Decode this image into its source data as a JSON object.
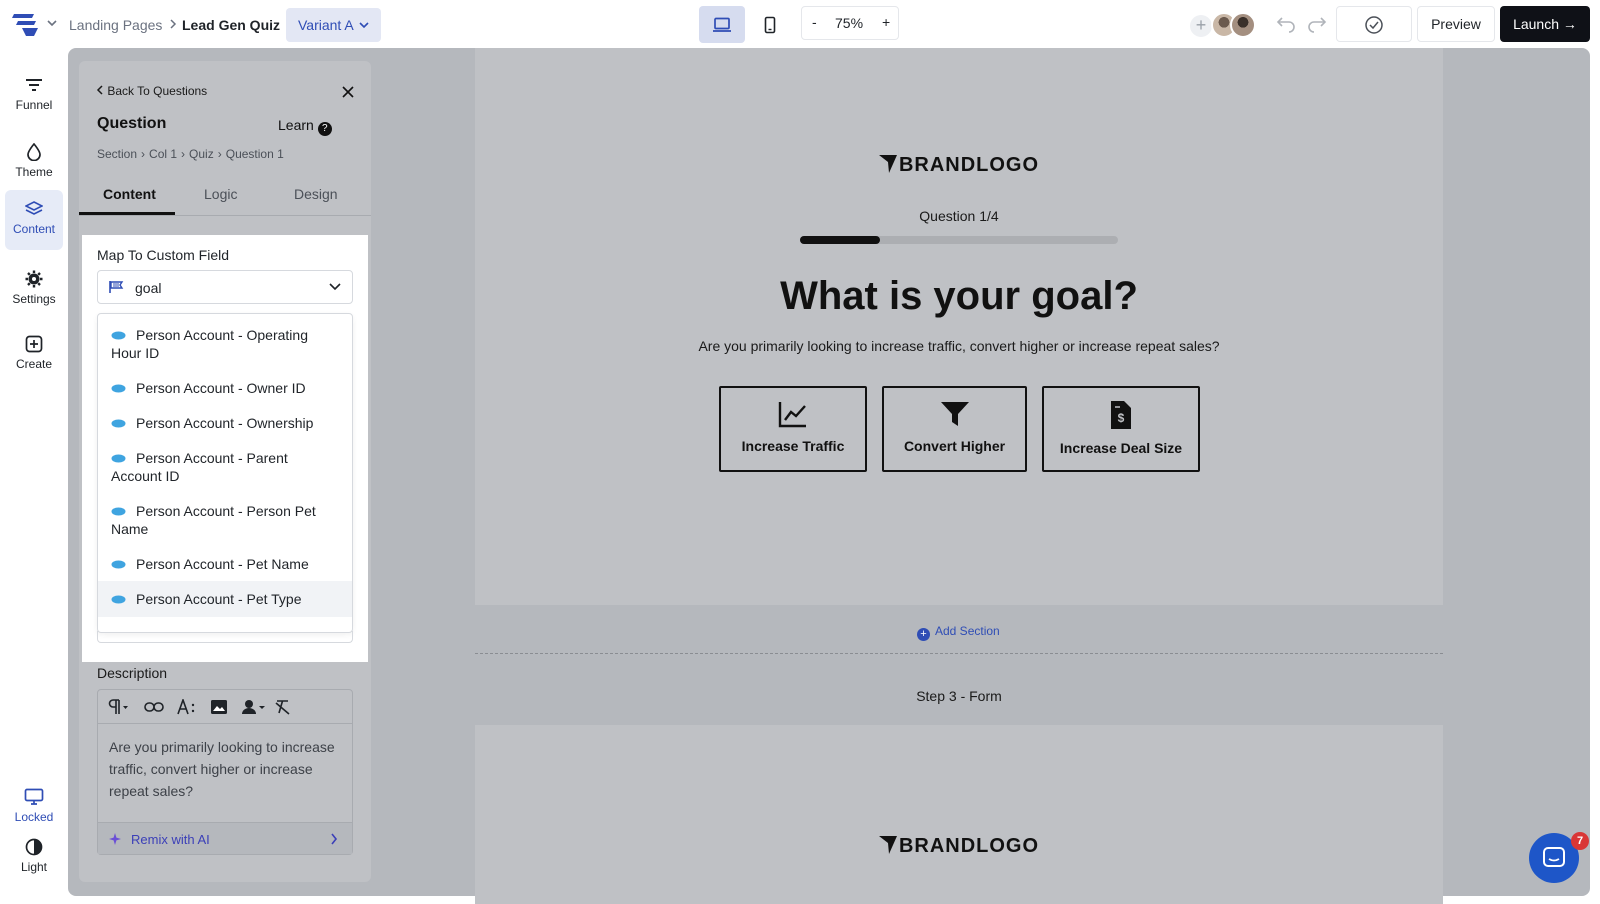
{
  "topbar": {
    "breadcrumb_parent": "Landing Pages",
    "breadcrumb_current": "Lead Gen Quiz",
    "variant": "Variant A",
    "zoom_minus": "-",
    "zoom_level": "75%",
    "zoom_plus": "+",
    "collab_add": "+",
    "preview": "Preview",
    "launch": "Launch →"
  },
  "rail": {
    "items": [
      {
        "label": "Funnel",
        "icon": "funnel-icon"
      },
      {
        "label": "Theme",
        "icon": "droplet-icon"
      },
      {
        "label": "Content",
        "icon": "layers-icon"
      },
      {
        "label": "Settings",
        "icon": "gear-icon"
      },
      {
        "label": "Create",
        "icon": "plus-square-icon"
      }
    ],
    "bottom": [
      {
        "label": "Locked",
        "icon": "monitor-icon"
      },
      {
        "label": "Light",
        "icon": "contrast-icon"
      }
    ]
  },
  "panel": {
    "back": "Back To Questions",
    "title": "Question",
    "learn": "Learn",
    "learn_icon": "?",
    "crumbs": [
      "Section",
      "Col 1",
      "Quiz",
      "Question 1"
    ],
    "tabs": [
      "Content",
      "Logic",
      "Design"
    ],
    "field_label": "Map To Custom Field",
    "field_value": "goal",
    "dropdown_options": [
      "Person Account - Operating Hour ID",
      "Person Account - Owner ID",
      "Person Account - Ownership",
      "Person Account - Parent Account ID",
      "Person Account - Person Pet Name",
      "Person Account - Pet Name",
      "Person Account - Pet Type"
    ],
    "description_label": "Description",
    "description_text": "Are you primarily looking to increase traffic, convert higher or increase repeat sales?",
    "remix": "Remix with AI"
  },
  "canvas": {
    "brandlogo": "BRANDLOGO",
    "question_count": "Question 1/4",
    "progress": 0.25,
    "question_title": "What is your goal?",
    "question_subtitle": "Are you primarily looking to increase traffic, convert higher or increase repeat sales?",
    "options": [
      {
        "label": "Increase Traffic",
        "icon": "line-chart-icon"
      },
      {
        "label": "Convert Higher",
        "icon": "funnel-filter-icon"
      },
      {
        "label": "Increase Deal Size",
        "icon": "invoice-dollar-icon"
      }
    ],
    "add_section": "Add Section",
    "step_label": "Step 3 - Form"
  },
  "chat": {
    "badge": "7"
  },
  "colors": {
    "accent": "#2f4db5",
    "launch_bg": "#0f1117",
    "canvas": "#b5b8bd",
    "chat": "#1e56c8"
  }
}
